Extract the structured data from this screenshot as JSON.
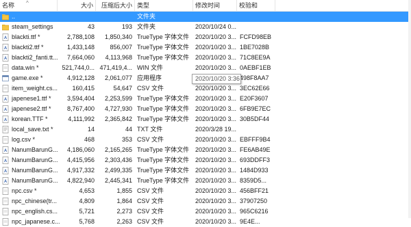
{
  "columns": {
    "name": "名称",
    "size": "大小",
    "compressed": "压缩后大小",
    "type": "类型",
    "modified": "修改时间",
    "crc": "校验和"
  },
  "tooltip": "2020/10/20 3:36",
  "rows": [
    {
      "name": "..",
      "size": "",
      "compressed": "",
      "type": "文件夹",
      "modified": "",
      "crc": "",
      "icon": "parent-folder-icon",
      "selected": true
    },
    {
      "name": "steam_settings",
      "size": "43",
      "compressed": "193",
      "type": "文件夹",
      "modified": "2020/10/24 0...",
      "crc": "",
      "icon": "folder-icon"
    },
    {
      "name": "blackti.ttf *",
      "size": "2,788,108",
      "compressed": "1,850,340",
      "type": "TrueType 字体文件",
      "modified": "2020/10/20 3...",
      "crc": "FCFD98EB",
      "icon": "font-file-icon"
    },
    {
      "name": "blackti2.ttf *",
      "size": "1,433,148",
      "compressed": "856,007",
      "type": "TrueType 字体文件",
      "modified": "2020/10/20 3...",
      "crc": "1BE7028B",
      "icon": "font-file-icon"
    },
    {
      "name": "blackti2_fanti.tt...",
      "size": "7,664,060",
      "compressed": "4,113,968",
      "type": "TrueType 字体文件",
      "modified": "2020/10/20 3...",
      "crc": "71C8EE9A",
      "icon": "font-file-icon"
    },
    {
      "name": "data.win *",
      "size": "521,744,0...",
      "compressed": "471,419,4...",
      "type": "WIN 文件",
      "modified": "2020/10/20 3...",
      "crc": "0AEBF1EB",
      "icon": "file-icon"
    },
    {
      "name": "game.exe *",
      "size": "4,912,128",
      "compressed": "2,061,077",
      "type": "应用程序",
      "modified": "",
      "crc": "498F8AA7",
      "icon": "exe-icon"
    },
    {
      "name": "item_weight.cs...",
      "size": "160,415",
      "compressed": "54,647",
      "type": "CSV 文件",
      "modified": "2020/10/20 3...",
      "crc": "3EC62E66",
      "icon": "file-icon"
    },
    {
      "name": "japenese1.ttf *",
      "size": "3,594,404",
      "compressed": "2,253,599",
      "type": "TrueType 字体文件",
      "modified": "2020/10/20 3...",
      "crc": "E20F3607",
      "icon": "font-file-icon"
    },
    {
      "name": "japenese2.ttf *",
      "size": "8,767,400",
      "compressed": "4,727,930",
      "type": "TrueType 字体文件",
      "modified": "2020/10/20 3...",
      "crc": "6FB9E7EC",
      "icon": "font-file-icon"
    },
    {
      "name": "korean.TTF *",
      "size": "4,111,992",
      "compressed": "2,365,842",
      "type": "TrueType 字体文件",
      "modified": "2020/10/20 3...",
      "crc": "30B5DF44",
      "icon": "font-file-icon"
    },
    {
      "name": "local_save.txt *",
      "size": "14",
      "compressed": "44",
      "type": "TXT 文件",
      "modified": "2020/3/28 19...",
      "crc": "",
      "icon": "text-file-icon"
    },
    {
      "name": "log.csv *",
      "size": "468",
      "compressed": "353",
      "type": "CSV 文件",
      "modified": "2020/10/20 3...",
      "crc": "EBFFF9B4",
      "icon": "file-icon"
    },
    {
      "name": "NanumBarunG...",
      "size": "4,186,060",
      "compressed": "2,165,265",
      "type": "TrueType 字体文件",
      "modified": "2020/10/20 3...",
      "crc": "FE6AB49E",
      "icon": "font-file-icon"
    },
    {
      "name": "NanumBarunG...",
      "size": "4,415,956",
      "compressed": "2,303,436",
      "type": "TrueType 字体文件",
      "modified": "2020/10/20 3...",
      "crc": "693DDFF3",
      "icon": "font-file-icon"
    },
    {
      "name": "NanumBarunG...",
      "size": "4,917,332",
      "compressed": "2,499,335",
      "type": "TrueType 字体文件",
      "modified": "2020/10/20 3...",
      "crc": "1484D933",
      "icon": "font-file-icon"
    },
    {
      "name": "NanumBarunG...",
      "size": "4,822,940",
      "compressed": "2,445,341",
      "type": "TrueType 字体文件",
      "modified": "2020/10/20 3...",
      "crc": "8359D5...",
      "icon": "font-file-icon"
    },
    {
      "name": "npc.csv *",
      "size": "4,653",
      "compressed": "1,855",
      "type": "CSV 文件",
      "modified": "2020/10/20 3...",
      "crc": "456BFF21",
      "icon": "file-icon"
    },
    {
      "name": "npc_chinese(tr...",
      "size": "4,809",
      "compressed": "1,864",
      "type": "CSV 文件",
      "modified": "2020/10/20 3...",
      "crc": "37907250",
      "icon": "file-icon"
    },
    {
      "name": "npc_english.cs...",
      "size": "5,721",
      "compressed": "2,273",
      "type": "CSV 文件",
      "modified": "2020/10/20 3...",
      "crc": "965C6216",
      "icon": "file-icon"
    },
    {
      "name": "npc_japanese.c...",
      "size": "5,768",
      "compressed": "2,263",
      "type": "CSV 文件",
      "modified": "2020/10/20 3...",
      "crc": "9E4E...",
      "icon": "file-icon"
    }
  ]
}
